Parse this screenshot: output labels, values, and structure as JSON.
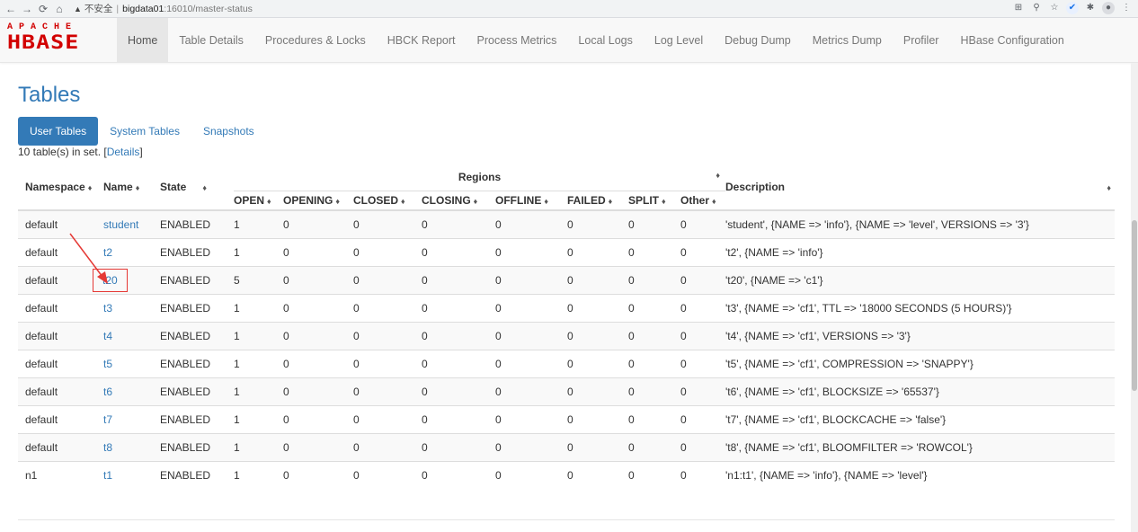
{
  "browser": {
    "security_label": "不安全",
    "host": "bigdata01",
    "path": ":16010/master-status"
  },
  "logo": {
    "top": "APACHE",
    "main": "HBASE"
  },
  "nav": [
    {
      "label": "Home",
      "active": true
    },
    {
      "label": "Table Details"
    },
    {
      "label": "Procedures & Locks"
    },
    {
      "label": "HBCK Report"
    },
    {
      "label": "Process Metrics"
    },
    {
      "label": "Local Logs"
    },
    {
      "label": "Log Level"
    },
    {
      "label": "Debug Dump"
    },
    {
      "label": "Metrics Dump"
    },
    {
      "label": "Profiler"
    },
    {
      "label": "HBase Configuration"
    }
  ],
  "page": {
    "title": "Tables",
    "tabs": [
      "User Tables",
      "System Tables",
      "Snapshots"
    ],
    "count_text": "10 table(s) in set. [",
    "count_link": "Details",
    "count_close": "]"
  },
  "table": {
    "headers": {
      "namespace": "Namespace",
      "name": "Name",
      "state": "State",
      "regions": "Regions",
      "description": "Description",
      "regions_cols": [
        "OPEN",
        "OPENING",
        "CLOSED",
        "CLOSING",
        "OFFLINE",
        "FAILED",
        "SPLIT",
        "Other"
      ]
    },
    "sort_glyph": "♦",
    "rows": [
      {
        "ns": "default",
        "name": "student",
        "state": "ENABLED",
        "r": [
          "1",
          "0",
          "0",
          "0",
          "0",
          "0",
          "0",
          "0"
        ],
        "desc": "'student', {NAME => 'info'}, {NAME => 'level', VERSIONS => '3'}"
      },
      {
        "ns": "default",
        "name": "t2",
        "state": "ENABLED",
        "r": [
          "1",
          "0",
          "0",
          "0",
          "0",
          "0",
          "0",
          "0"
        ],
        "desc": "'t2', {NAME => 'info'}"
      },
      {
        "ns": "default",
        "name": "t20",
        "state": "ENABLED",
        "r": [
          "5",
          "0",
          "0",
          "0",
          "0",
          "0",
          "0",
          "0"
        ],
        "desc": "'t20', {NAME => 'c1'}"
      },
      {
        "ns": "default",
        "name": "t3",
        "state": "ENABLED",
        "r": [
          "1",
          "0",
          "0",
          "0",
          "0",
          "0",
          "0",
          "0"
        ],
        "desc": "'t3', {NAME => 'cf1', TTL => '18000 SECONDS (5 HOURS)'}"
      },
      {
        "ns": "default",
        "name": "t4",
        "state": "ENABLED",
        "r": [
          "1",
          "0",
          "0",
          "0",
          "0",
          "0",
          "0",
          "0"
        ],
        "desc": "'t4', {NAME => 'cf1', VERSIONS => '3'}"
      },
      {
        "ns": "default",
        "name": "t5",
        "state": "ENABLED",
        "r": [
          "1",
          "0",
          "0",
          "0",
          "0",
          "0",
          "0",
          "0"
        ],
        "desc": "'t5', {NAME => 'cf1', COMPRESSION => 'SNAPPY'}"
      },
      {
        "ns": "default",
        "name": "t6",
        "state": "ENABLED",
        "r": [
          "1",
          "0",
          "0",
          "0",
          "0",
          "0",
          "0",
          "0"
        ],
        "desc": "'t6', {NAME => 'cf1', BLOCKSIZE => '65537'}"
      },
      {
        "ns": "default",
        "name": "t7",
        "state": "ENABLED",
        "r": [
          "1",
          "0",
          "0",
          "0",
          "0",
          "0",
          "0",
          "0"
        ],
        "desc": "'t7', {NAME => 'cf1', BLOCKCACHE => 'false'}"
      },
      {
        "ns": "default",
        "name": "t8",
        "state": "ENABLED",
        "r": [
          "1",
          "0",
          "0",
          "0",
          "0",
          "0",
          "0",
          "0"
        ],
        "desc": "'t8', {NAME => 'cf1', BLOOMFILTER => 'ROWCOL'}"
      },
      {
        "ns": "n1",
        "name": "t1",
        "state": "ENABLED",
        "r": [
          "1",
          "0",
          "0",
          "0",
          "0",
          "0",
          "0",
          "0"
        ],
        "desc": "'n1:t1', {NAME => 'info'}, {NAME => 'level'}"
      }
    ]
  },
  "annotation": {
    "highlight_row": 2,
    "color": "#e53935"
  }
}
